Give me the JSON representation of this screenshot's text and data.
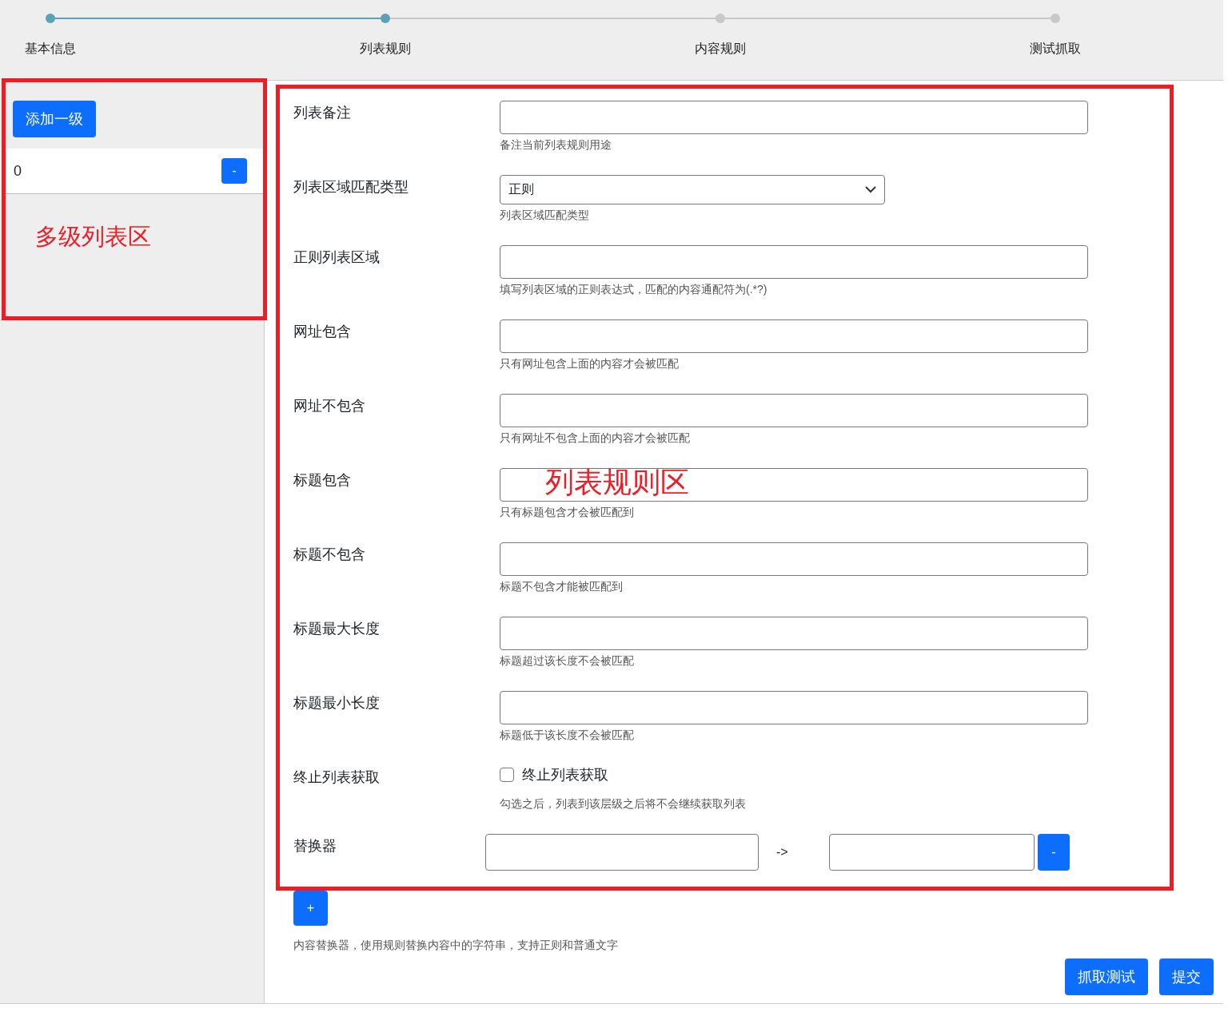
{
  "steps": [
    {
      "label": "基本信息",
      "completed": true
    },
    {
      "label": "列表规则",
      "completed": true
    },
    {
      "label": "内容规则",
      "completed": false
    },
    {
      "label": "测试抓取",
      "completed": false
    }
  ],
  "levels_panel": {
    "add_button": "添加一级",
    "levels": [
      {
        "label": "0",
        "remove_button": "-"
      }
    ]
  },
  "form": {
    "fields": [
      {
        "kind": "text",
        "label": "列表备注",
        "help": "备注当前列表规则用途"
      },
      {
        "kind": "select",
        "label": "列表区域匹配类型",
        "value": "正则",
        "help": "列表区域匹配类型"
      },
      {
        "kind": "text",
        "label": "正则列表区域",
        "help": "填写列表区域的正则表达式，匹配的内容通配符为(.*?)"
      },
      {
        "kind": "text",
        "label": "网址包含",
        "help": "只有网址包含上面的内容才会被匹配"
      },
      {
        "kind": "text",
        "label": "网址不包含",
        "help": "只有网址不包含上面的内容才会被匹配"
      },
      {
        "kind": "text",
        "label": "标题包含",
        "help": "只有标题包含才会被匹配到"
      },
      {
        "kind": "text",
        "label": "标题不包含",
        "help": "标题不包含才能被匹配到"
      },
      {
        "kind": "text",
        "label": "标题最大长度",
        "help": "标题超过该长度不会被匹配"
      },
      {
        "kind": "text",
        "label": "标题最小长度",
        "help": "标题低于该长度不会被匹配"
      },
      {
        "kind": "checkbox",
        "label": "终止列表获取",
        "option": "终止列表获取",
        "checked": false,
        "help": "勾选之后，列表到该层级之后将不会继续获取列表"
      },
      {
        "kind": "replacer",
        "label": "替换器",
        "arrow": "->",
        "remove_button": "-"
      }
    ],
    "add_replacer_button": "+",
    "replacer_help": "内容替换器，使用规则替换内容中的字符串，支持正则和普通文字",
    "actions": [
      "抓取测试",
      "提交"
    ]
  },
  "annotations": [
    {
      "label": "多级列表区"
    },
    {
      "label": "列表规则区"
    }
  ]
}
